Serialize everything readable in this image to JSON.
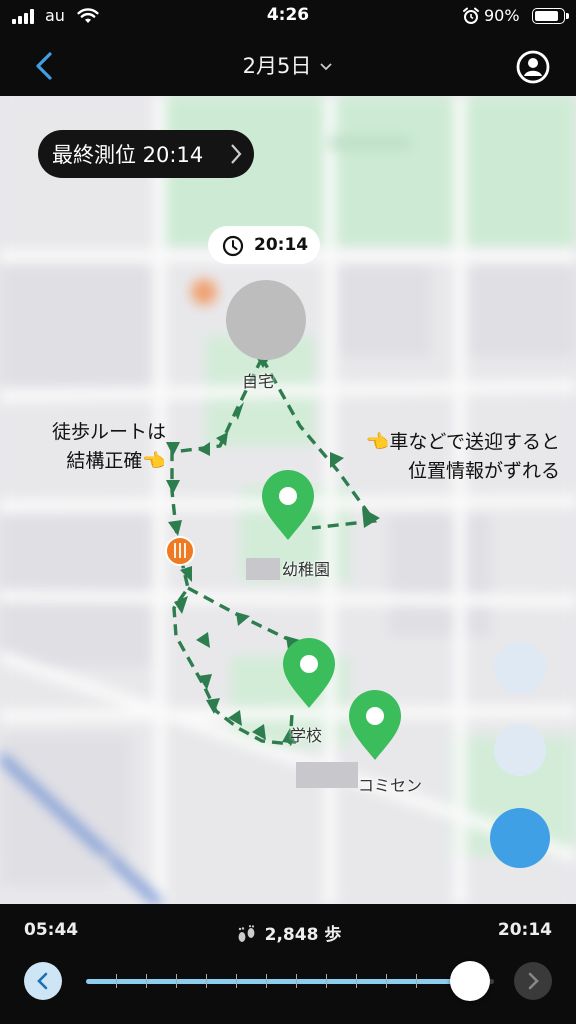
{
  "status_bar": {
    "carrier": "au",
    "time": "4:26",
    "battery_percent": "90%",
    "battery_level": 0.9
  },
  "nav": {
    "date_title": "2月5日"
  },
  "map": {
    "last_position_label": "最終測位 20:14",
    "current_time_label": "20:14",
    "places": {
      "home": "自宅",
      "kindergarten": "幼稚園",
      "school": "学校",
      "community_center": "コミセン"
    },
    "notes": {
      "left_line1": "徒歩ルートは",
      "left_line2": "結構正確👈",
      "right_line1": "👈車などで送迎すると",
      "right_line2": "位置情報がずれる"
    }
  },
  "timeline": {
    "start_time": "05:44",
    "end_time": "20:14",
    "steps": "2,848 歩",
    "slider_value": 1.0
  },
  "colors": {
    "accent_blue": "#3fa0e6",
    "route_green": "#2e7d4e",
    "pin_green": "#3bbd5c",
    "slider_fill": "#8ccdf0"
  }
}
